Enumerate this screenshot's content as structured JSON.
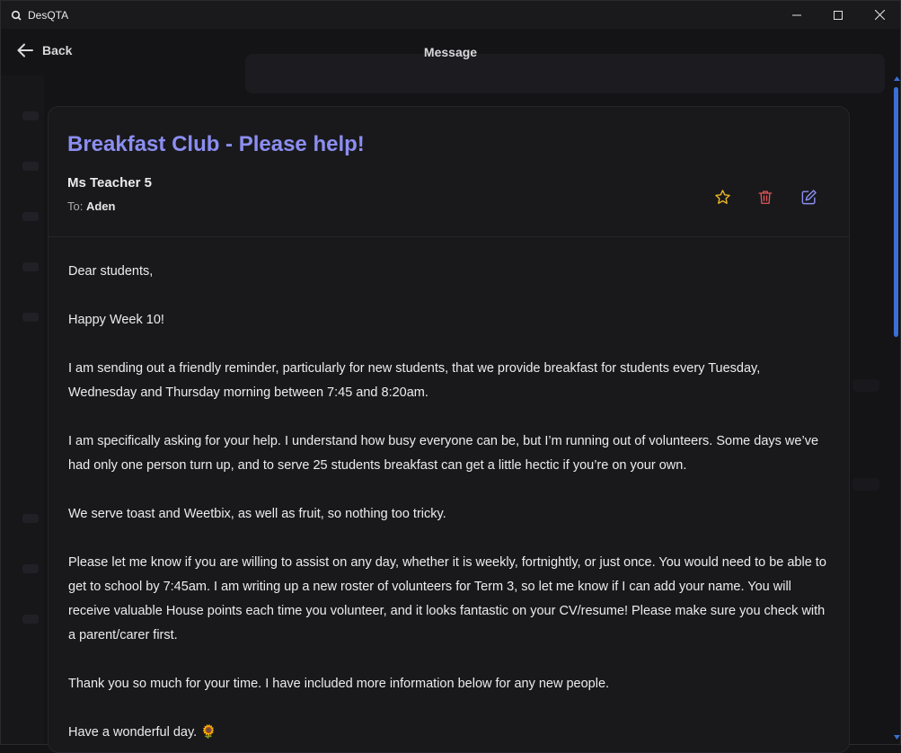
{
  "window": {
    "title": "DesQTA"
  },
  "header": {
    "back_label": "Back",
    "title": "Message"
  },
  "message": {
    "subject": "Breakfast Club - Please help!",
    "sender": "Ms Teacher 5",
    "to_prefix": "To:",
    "to_name": "Aden",
    "paragraphs": [
      "Dear students,",
      "Happy Week 10!",
      "I am sending out a friendly reminder, particularly for new students, that we provide breakfast for students every Tuesday, Wednesday and Thursday morning between 7:45 and 8:20am.",
      "I am specifically asking for your help. I understand how busy everyone can be, but I’m running out of volunteers. Some days we’ve had only one person turn up, and to serve 25 students breakfast can get a little hectic if you’re on your own.",
      "We serve toast and Weetbix, as well as fruit, so nothing too tricky.",
      "Please let me know if you are willing to assist on any day, whether it is weekly, fortnightly, or just once. You would need to be able to get to school by 7:45am. I am writing up a new roster of volunteers for Term 3, so let me know if I can add your name. You will receive valuable House points each time you volunteer, and it looks fantastic on your CV/resume! Please make sure you check with a parent/carer first.",
      "Thank you so much for your time. I have included more information below for any new people.",
      "Have a wonderful day. 🌻"
    ]
  },
  "icons": {
    "star": "star-icon",
    "trash": "trash-icon",
    "edit": "edit-icon"
  },
  "colors": {
    "accent": "#8b8ef0",
    "star": "#e6b422",
    "trash": "#e05555",
    "edit": "#8b8ef0",
    "scrollbar": "#3b6fd6"
  }
}
